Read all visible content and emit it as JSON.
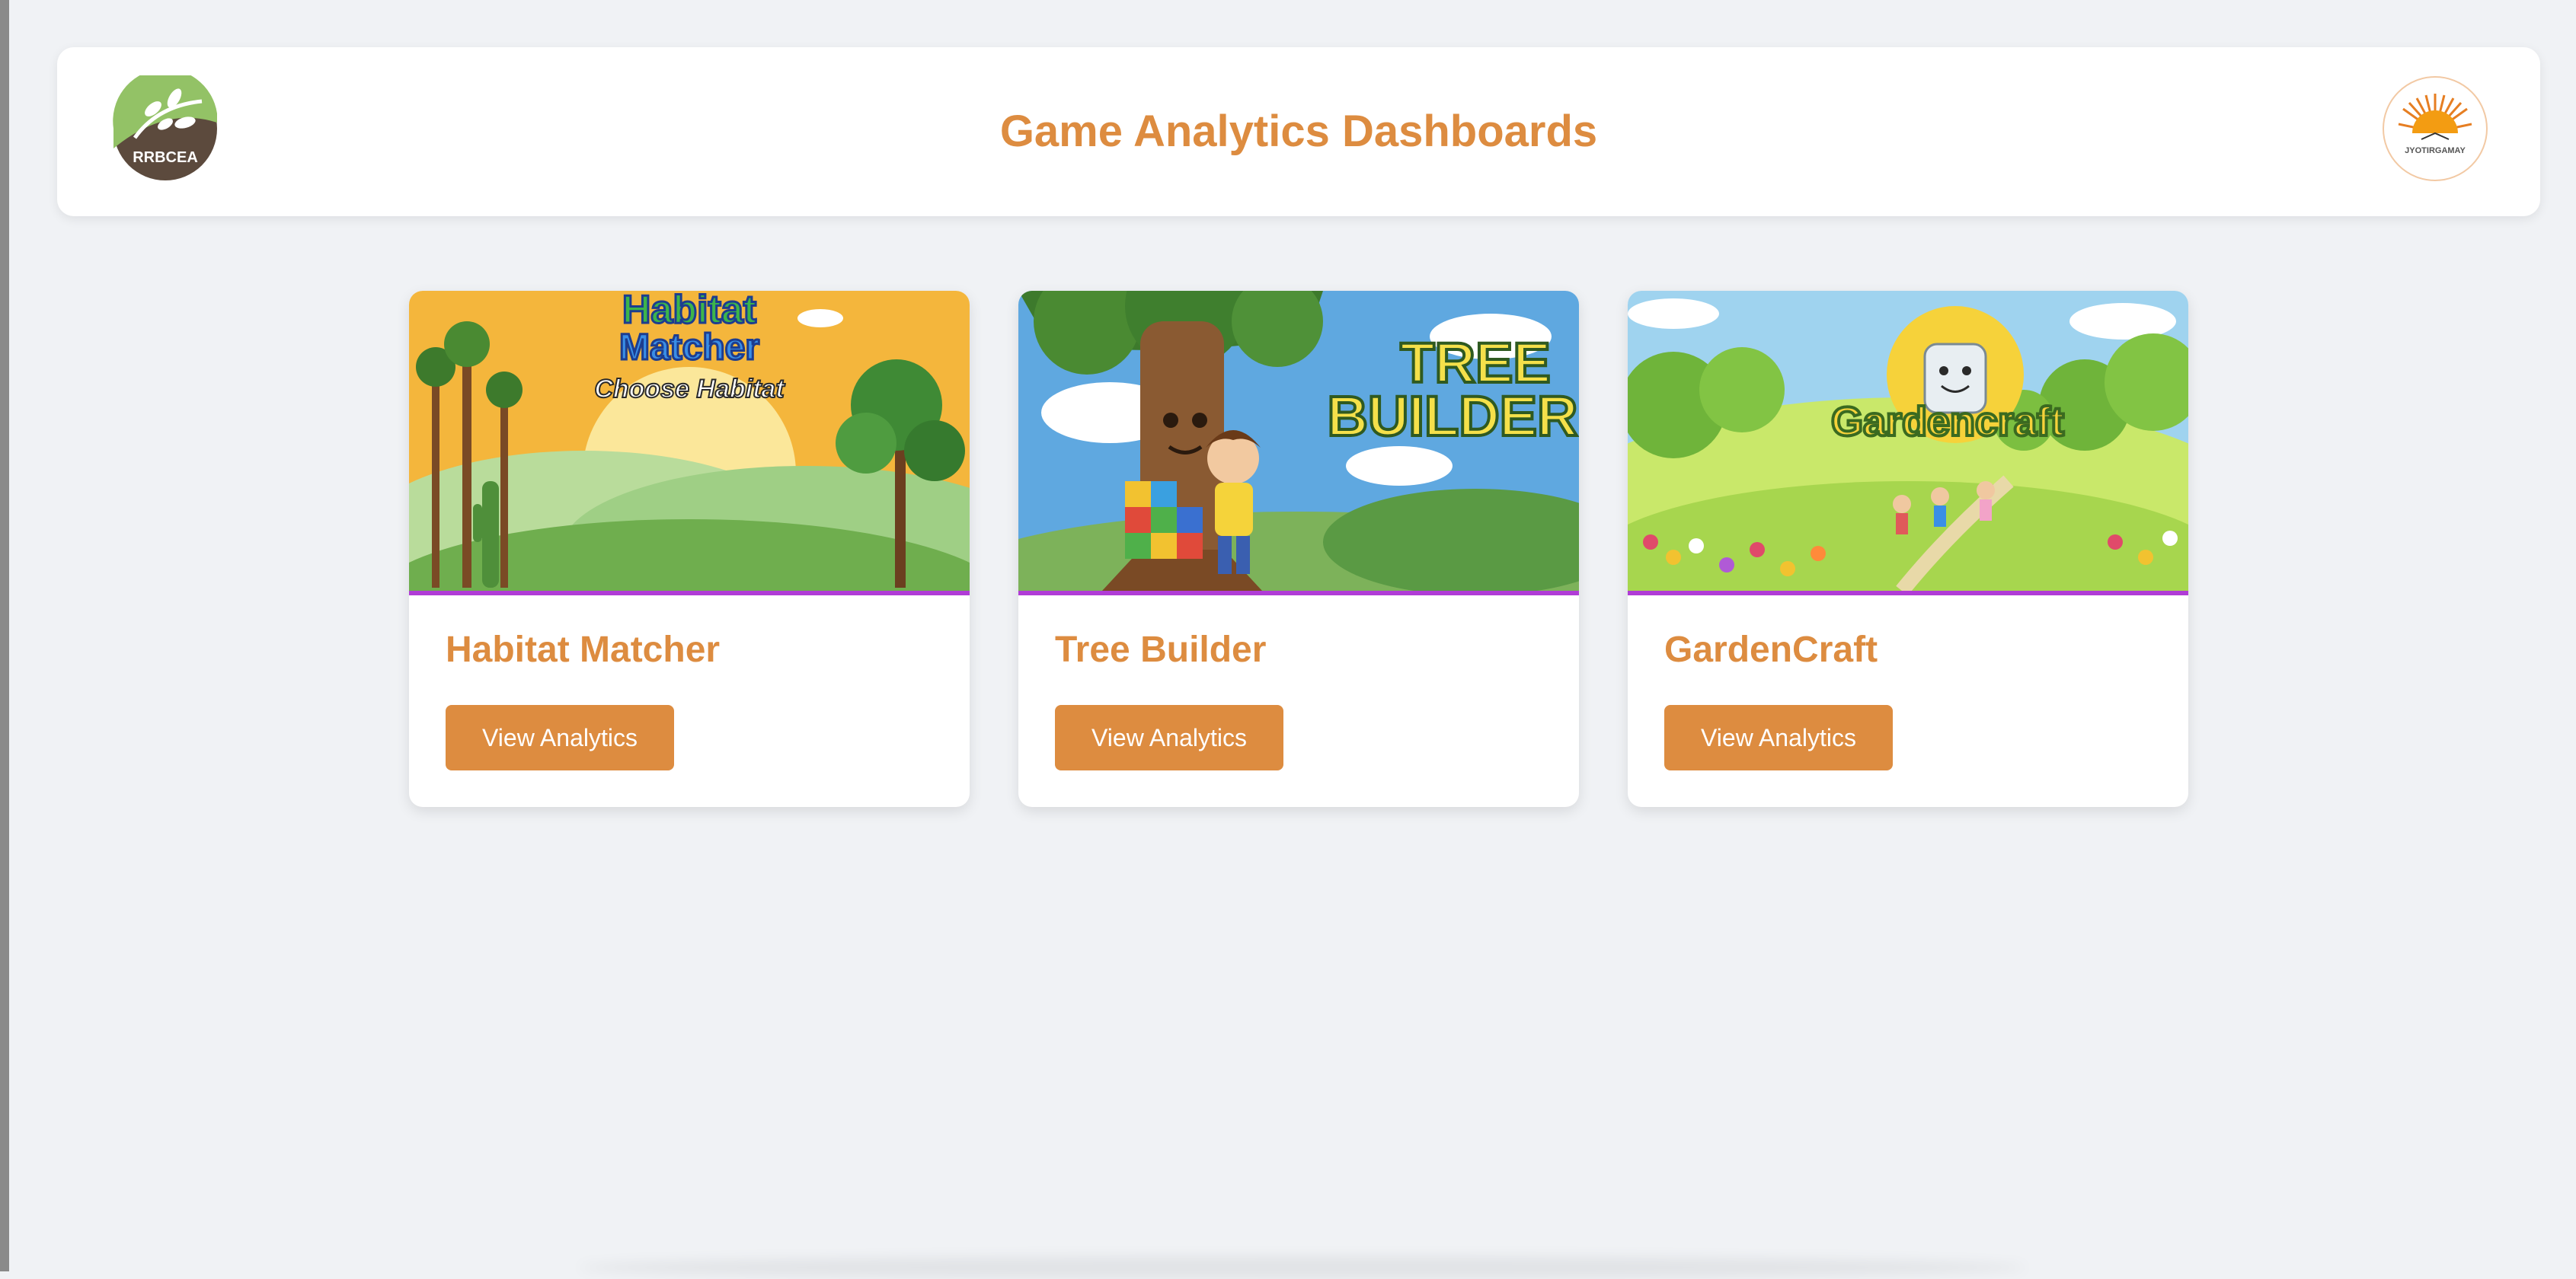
{
  "header": {
    "title": "Game Analytics Dashboards",
    "left_logo": {
      "icon": "rrbcea-leaf-logo-icon",
      "text": "RRBCEA"
    },
    "right_logo": {
      "icon": "jyotirgamay-sun-logo-icon",
      "text": "JYOTIRGAMAY"
    }
  },
  "cards": [
    {
      "title": "Habitat Matcher",
      "button_label": "View Analytics",
      "image": {
        "icon": "habitat-matcher-thumbnail-icon",
        "headline_1": "Habitat",
        "headline_2": "Matcher",
        "tagline": "Choose Habitat"
      }
    },
    {
      "title": "Tree Builder",
      "button_label": "View Analytics",
      "image": {
        "icon": "tree-builder-thumbnail-icon",
        "headline_1": "TREE",
        "headline_2": "BUILDER"
      }
    },
    {
      "title": "GardenCraft",
      "button_label": "View Analytics",
      "image": {
        "icon": "gardencraft-thumbnail-icon",
        "headline_1": "Gardencraft"
      }
    }
  ],
  "colors": {
    "accent": "#dd8c40",
    "page_background": "#f0f2f5",
    "card_background": "#ffffff",
    "image_divider": "#b03cd6"
  }
}
